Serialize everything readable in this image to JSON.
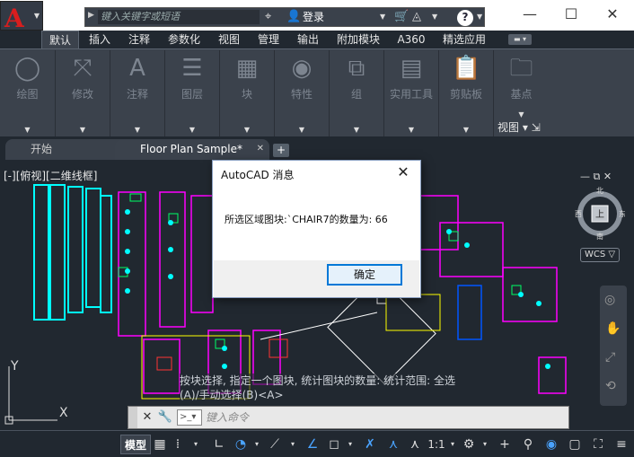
{
  "titlebar": {
    "search_placeholder": "键入关键字或短语",
    "login_label": "登录",
    "help_label": "?"
  },
  "ribbon_tabs": [
    {
      "label": "默认",
      "active": true
    },
    {
      "label": "插入"
    },
    {
      "label": "注释"
    },
    {
      "label": "参数化"
    },
    {
      "label": "视图"
    },
    {
      "label": "管理"
    },
    {
      "label": "输出"
    },
    {
      "label": "附加模块"
    },
    {
      "label": "A360"
    },
    {
      "label": "精选应用"
    }
  ],
  "ribbon_panels": [
    {
      "label": "绘图"
    },
    {
      "label": "修改"
    },
    {
      "label": "注释"
    },
    {
      "label": "图层"
    },
    {
      "label": "块"
    },
    {
      "label": "特性"
    },
    {
      "label": "组"
    },
    {
      "label": "实用工具"
    },
    {
      "label": "剪贴板"
    },
    {
      "label": "基点"
    },
    {
      "label": "视图"
    }
  ],
  "file_tabs": [
    {
      "label": "开始"
    },
    {
      "label": "Floor Plan Sample*",
      "active": true
    }
  ],
  "viewport": {
    "label": "[-][俯视][二维线框]",
    "navcube": {
      "north": "北",
      "east": "东",
      "west": "西",
      "top": "上",
      "south": "南"
    },
    "wcs_label": "WCS"
  },
  "command_history": {
    "line1": "按块选择, 指定一个图块, 统计图块的数量: 统计范围: 全选",
    "line2": "(A)/手动选择(B)<A>"
  },
  "command_line": {
    "placeholder": "键入命令"
  },
  "ucs": {
    "x": "X",
    "y": "Y"
  },
  "statusbar": {
    "model_label": "模型",
    "scale_label": "1:1"
  },
  "dialog": {
    "title": "AutoCAD 消息",
    "message": "所选区域图块:`CHAIR7的数量为: 66",
    "ok_label": "确定"
  }
}
